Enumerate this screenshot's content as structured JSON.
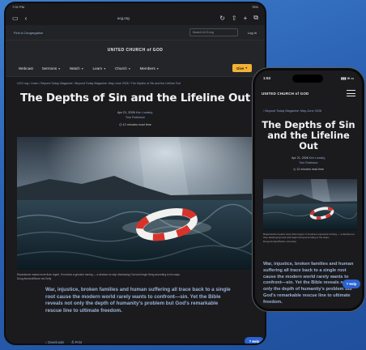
{
  "tablet": {
    "status": {
      "time": "7:02 PM",
      "day": "Wed Jun 14",
      "battery": "76%"
    },
    "safari": {
      "url": "ucg.org"
    },
    "util": {
      "find_congregation": "Find a Congregation",
      "search_placeholder": "Search UCG.org",
      "login": "Log In"
    },
    "brand": "UNITED CHURCH of GOD",
    "nav": [
      "Webcast",
      "Sermons",
      "Watch",
      "Learn",
      "Church",
      "Members"
    ],
    "give": "Give",
    "breadcrumb": "UCG.org / Learn / Beyond Today Magazine / Beyond Today Magazine: May-June 2026 / The Depths of Sin and the Lifeline Out",
    "title": "The Depths of Sin and the Lifeline Out",
    "date": "Apr 21, 2026",
    "author1": "Ken Lowsky,",
    "author2": "Tom Robinson",
    "read_time": "12 minutes read time",
    "caption_1": "Repentance means more than regret. It involves a genuine turning — a decision to stop disobeying God and begin living according to his ways.",
    "caption_2": "Doug Armand/Stone via Getty",
    "lede": "War, injustice, broken families and human suffering all trace back to a single root cause the modern world rarely wants to confront—sin. Yet the Bible reveals not only the depth of humanity's problem but God's remarkable rescue line to ultimate freedom.",
    "downloads": "Downloads",
    "print": "Print",
    "help": "Help"
  },
  "phone": {
    "status": {
      "time": "1:53"
    },
    "brand": "UNITED CHURCH of GOD",
    "back": "Beyond Today Magazine: May-June 2026",
    "title": "The Depths of Sin and the Lifeline Out",
    "date": "Apr 21, 2026",
    "author1": "Ken Lowsky,",
    "author2": "Tom Robinson",
    "read_time": "12 minutes read time",
    "caption_1": "Repentance means more than regret. It involves a genuine turning — a decision to stop disobeying God and begin living according to his ways.",
    "caption_2": "Doug Armand/Stone via Getty",
    "lede": "War, injustice, broken families and human suffering all trace back to a single root cause the modern world rarely wants to confront—sin. Yet the Bible reveals not only the depth of humanity's problem but God's remarkable rescue line to ultimate freedom.",
    "help": "Help"
  },
  "colors": {
    "accent_give": "#f3b233",
    "help_button": "#2b63d1",
    "link": "#8ea7d2",
    "lede": "#9bb3d8",
    "background": "#2c63b4"
  }
}
